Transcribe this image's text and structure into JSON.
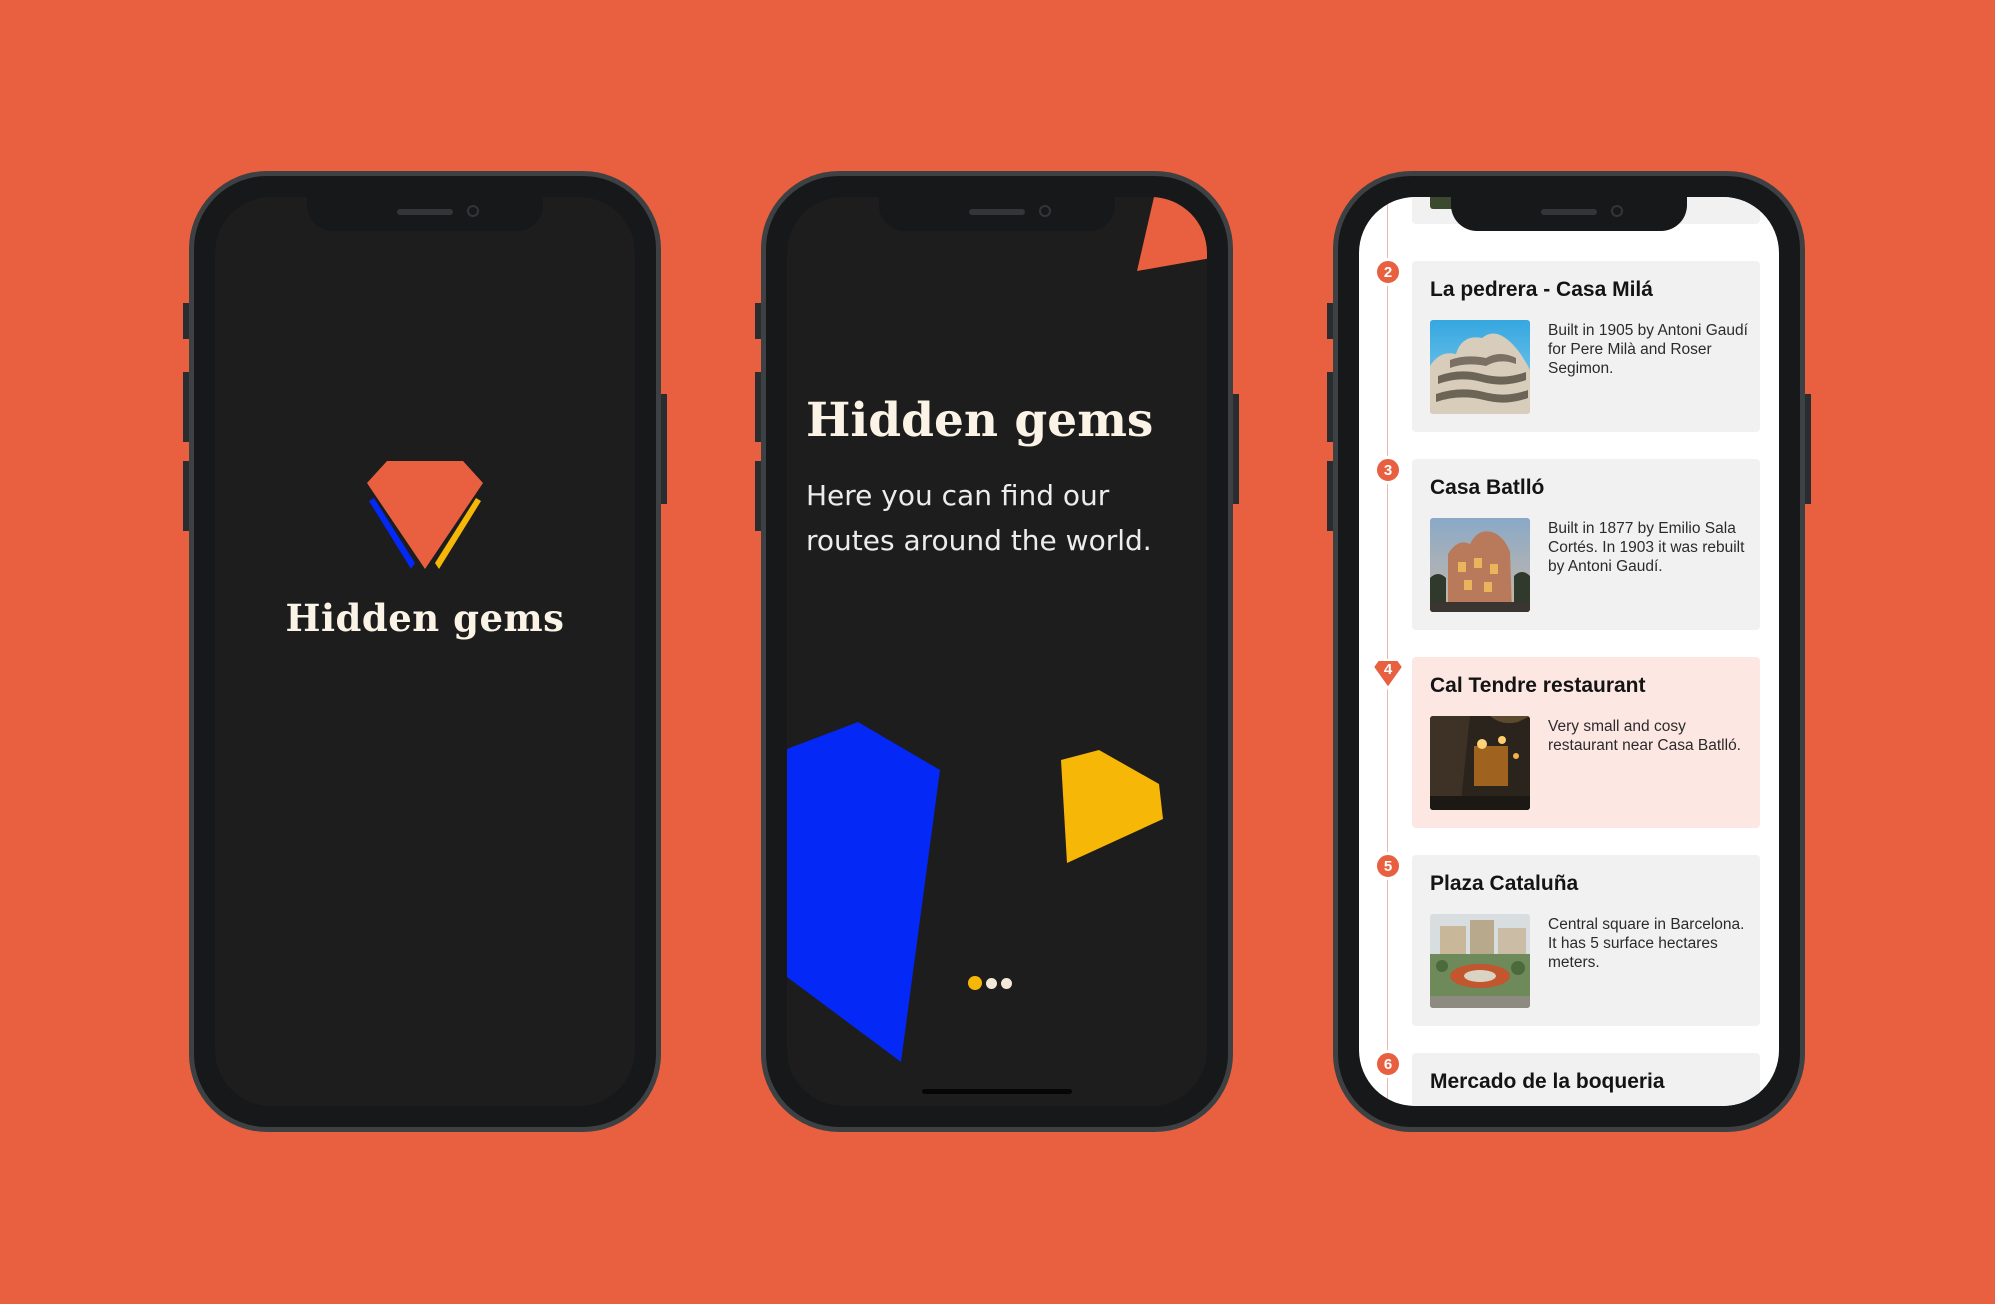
{
  "colors": {
    "background": "#E8603F",
    "screen_dark": "#1D1D1D",
    "accent_orange": "#E8603F",
    "accent_blue": "#0428F5",
    "accent_yellow": "#F7B707",
    "title_text": "#FAF3E6",
    "card_bg": "#F1F1F1",
    "card_highlight_bg": "#FCE7E2"
  },
  "splash": {
    "logo_icon": "gem-icon",
    "title": "Hidden gems"
  },
  "onboarding": {
    "title": "Hidden gems",
    "subtitle": "Here you can find our routes around the world.",
    "pagination": {
      "total": 3,
      "active": 1
    }
  },
  "route_list": {
    "items": [
      {
        "number": "2",
        "title": "La pedrera - Casa Milá",
        "description": "Built in 1905 by Antoni Gaudí for Pere Milà and Roser Segimon.",
        "highlighted": false
      },
      {
        "number": "3",
        "title": "Casa Batlló",
        "description": "Built in 1877 by Emilio Sala Cortés. In 1903 it was rebuilt by Antoni Gaudí.",
        "highlighted": false
      },
      {
        "number": "4",
        "title": "Cal Tendre restaurant",
        "description": "Very small and cosy restaurant near Casa Batlló.",
        "highlighted": true
      },
      {
        "number": "5",
        "title": "Plaza Cataluña",
        "description": "Central square in Barcelona. It has 5 surface hectares meters.",
        "highlighted": false
      },
      {
        "number": "6",
        "title": "Mercado de la boqueria",
        "description": "",
        "highlighted": false
      }
    ]
  }
}
